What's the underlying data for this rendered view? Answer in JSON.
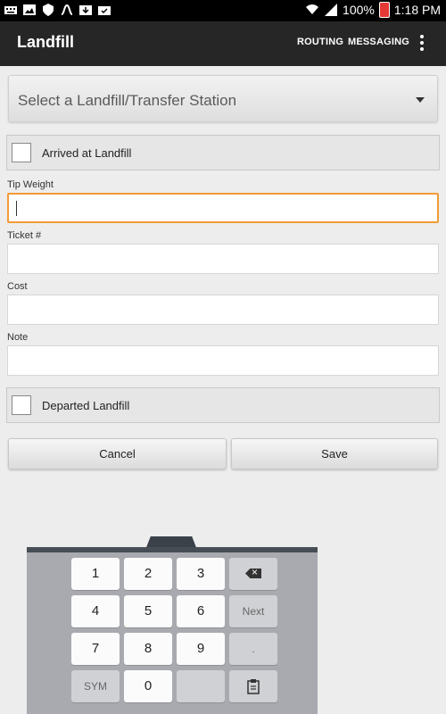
{
  "status_bar": {
    "battery": "100%",
    "time": "1:18 PM",
    "battery_color": "#e53935"
  },
  "app_bar": {
    "title": "Landfill",
    "actions": [
      "ROUTING",
      "MESSAGING"
    ]
  },
  "form": {
    "spinner_placeholder": "Select a Landfill/Transfer Station",
    "arrived_label": "Arrived at Landfill",
    "fields": [
      {
        "label": "Tip Weight",
        "value": ""
      },
      {
        "label": "Ticket #",
        "value": ""
      },
      {
        "label": "Cost",
        "value": ""
      },
      {
        "label": "Note",
        "value": ""
      }
    ],
    "departed_label": "Departed Landfill",
    "cancel_label": "Cancel",
    "save_label": "Save",
    "focus_color": "#f29b36"
  },
  "keyboard": {
    "rows": [
      [
        "1",
        "2",
        "3",
        "backspace-icon"
      ],
      [
        "4",
        "5",
        "6",
        "Next"
      ],
      [
        "7",
        "8",
        "9",
        "."
      ],
      [
        "SYM",
        "0",
        "",
        "clipboard-icon"
      ]
    ]
  }
}
